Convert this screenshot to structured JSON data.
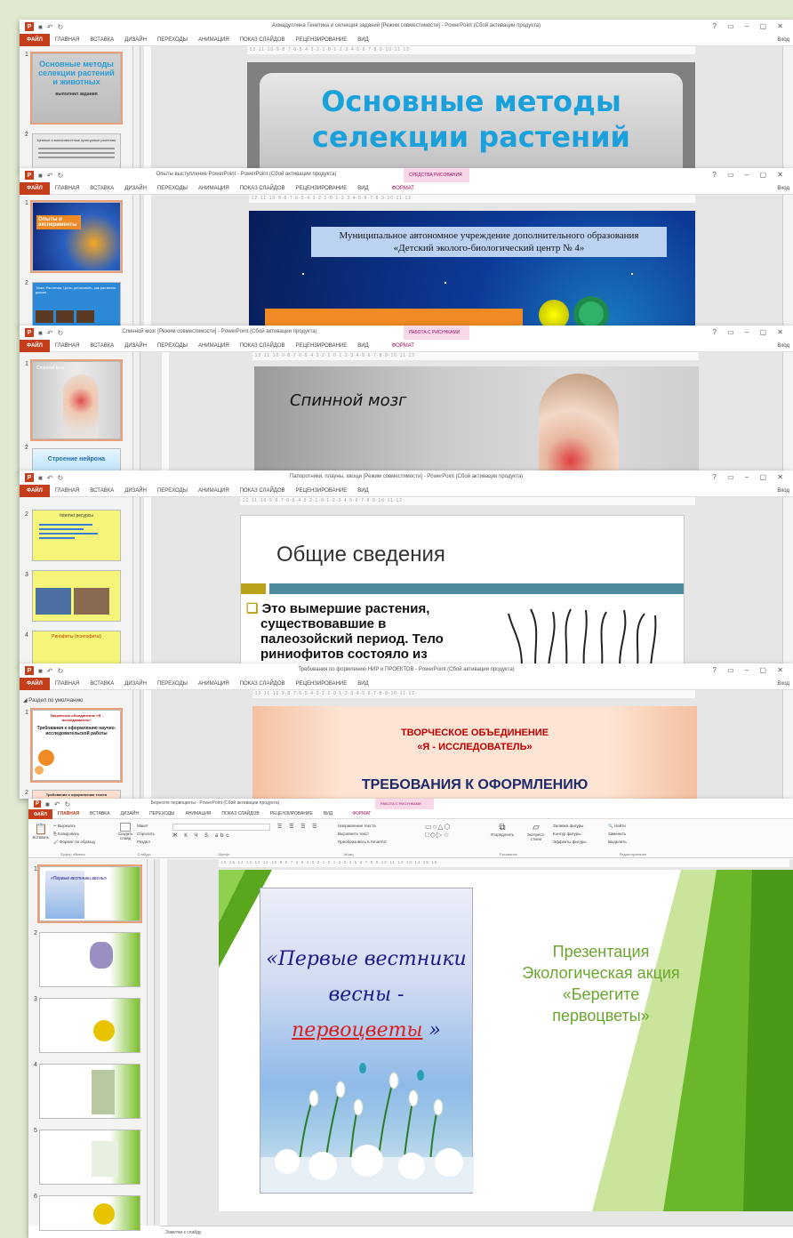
{
  "window_controls": "? ▭ – ▢ ✕",
  "w1": {
    "title": "Ахмадуллина Генетика и селекция заданий [Режим совместимости] - PowerPoint (Сбой активации продукта)",
    "tabs": [
      "ФАЙЛ",
      "ГЛАВНАЯ",
      "ВСТАВКА",
      "ДИЗАЙН",
      "ПЕРЕХОДЫ",
      "АНИМАЦИЯ",
      "ПОКАЗ СЛАЙДОВ",
      "РЕЦЕНЗИРОВАНИЕ",
      "ВИД"
    ],
    "signin": "Вход",
    "thumb1_title": "Основные методы селекции растений и животных",
    "thumb1_sub": "выполнил задания",
    "thumb2_title": "Ценные и малоизвестные культурные растения",
    "slide_title": "Основные методы селекции растений"
  },
  "w2": {
    "title": "Опыты выступление PowerPoint - PowerPoint (Сбой активации продукта)",
    "ctx": "СРЕДСТВА РИСОВАНИЯ",
    "tabs": [
      "ФАЙЛ",
      "ГЛАВНАЯ",
      "ВСТАВКА",
      "ДИЗАЙН",
      "ПЕРЕХОДЫ",
      "АНИМАЦИЯ",
      "ПОКАЗ СЛАЙДОВ",
      "РЕЦЕНЗИРОВАНИЕ",
      "ВИД",
      "ФОРМАТ"
    ],
    "signin": "Вход",
    "thumb1_title": "Опыты и эксперименты",
    "thumb2_title": "Тема: Растения. Цель: установить, как растения дышат",
    "slide_line1": "Муниципальное автономное учреждение дополнительного образования",
    "slide_line2": "«Детский эколого-биологический центр № 4»"
  },
  "w3": {
    "title": "Спинной мозг [Режим совместимости] - PowerPoint (Сбой активации продукта)",
    "ctx": "РАБОТА С РИСУНКАМИ",
    "tabs": [
      "ФАЙЛ",
      "ГЛАВНАЯ",
      "ВСТАВКА",
      "ДИЗАЙН",
      "ПЕРЕХОДЫ",
      "АНИМАЦИЯ",
      "ПОКАЗ СЛАЙДОВ",
      "РЕЦЕНЗИРОВАНИЕ",
      "ВИД",
      "ФОРМАТ"
    ],
    "signin": "Вход",
    "thumb1_title": "Спинной мозг",
    "thumb2_title": "Строение нейрона",
    "slide_title": "Спинной мозг"
  },
  "w4": {
    "title": "Папоротники, плауны, хвощи [Режим совместимости] - PowerPoint (Сбой активации продукта)",
    "tabs": [
      "ФАЙЛ",
      "ГЛАВНАЯ",
      "ВСТАВКА",
      "ДИЗАЙН",
      "ПЕРЕХОДЫ",
      "АНИМАЦИЯ",
      "ПОКАЗ СЛАЙДОВ",
      "РЕЦЕНЗИРОВАНИЕ",
      "ВИД"
    ],
    "signin": "Вход",
    "thumb2_title": "Internet ресурсы",
    "thumb4_title": "Ринофиты (псилофиты)",
    "slide_title": "Общие сведения",
    "slide_body": [
      "Это вымершие растения,",
      "существовавшие в",
      "палеозойский период. Тело",
      "риниофитов состояло из"
    ]
  },
  "w5": {
    "title": "Требования по формлению НИР и ПРОЕКТОВ - PowerPoint (Сбой активации продукта)",
    "tabs": [
      "ФАЙЛ",
      "ГЛАВНАЯ",
      "ВСТАВКА",
      "ДИЗАЙН",
      "ПЕРЕХОДЫ",
      "АНИМАЦИЯ",
      "ПОКАЗ СЛАЙДОВ",
      "РЕЦЕНЗИРОВАНИЕ",
      "ВИД"
    ],
    "signin": "Вход",
    "section": "◢ Раздел по умолчанию",
    "thumb1_title": "Творческое объединение «Я - исследователь»",
    "thumb1_sub": "Требования к оформлению научно-исследовательской работы",
    "thumb2_title": "Требования к оформлению текста",
    "slide_line1": "ТВОРЧЕСКОЕ ОБЪЕДИНЕНИЕ",
    "slide_line2": "«Я - ИССЛЕДОВАТЕЛЬ»",
    "slide_line3": "ТРЕБОВАНИЯ К ОФОРМЛЕНИЮ"
  },
  "w6": {
    "title": "Берегите первоцветы - PowerPoint (Сбой активации продукта)",
    "ctx": "РАБОТА С РИСУНКАМИ",
    "tabs": [
      "ФАЙЛ",
      "ГЛАВНАЯ",
      "ВСТАВКА",
      "ДИЗАЙН",
      "ПЕРЕХОДЫ",
      "АНИМАЦИЯ",
      "ПОКАЗ СЛАЙДОВ",
      "РЕЦЕНЗИРОВАНИЕ",
      "ВИД",
      "ФОРМАТ"
    ],
    "groups": [
      "Буфер обмена",
      "Слайды",
      "Шрифт",
      "Абзац",
      "Рисование",
      "Редактирование"
    ],
    "clip": [
      "Вырезать",
      "Копировать",
      "Формат по образцу"
    ],
    "slides_cmds": [
      "Макет",
      "Сбросить",
      "Раздел"
    ],
    "new_slide": "Создать слайд",
    "paste": "Вставить",
    "edit": [
      "Найти",
      "Заменить",
      "Выделить"
    ],
    "draw": [
      "Заливка фигуры",
      "Контур фигуры",
      "Эффекты фигуры"
    ],
    "arrange": "Упорядочить",
    "styles": "Экспресс-стили",
    "text_dir": [
      "Направление текста",
      "Выровнять текст",
      "Преобразовать в SmartArt"
    ],
    "thumb_nums": [
      "1",
      "2",
      "3",
      "4",
      "5",
      "6"
    ],
    "slide_img_line1": "«Первые вестники",
    "slide_img_line2a": "весны - ",
    "slide_img_line2b": "первоцветы",
    "slide_img_line2c": " »",
    "slide_text": [
      "Презентация",
      "Экологическая акция",
      "«Берегите",
      "первоцветы»"
    ],
    "notes": "Заметки к слайду"
  }
}
